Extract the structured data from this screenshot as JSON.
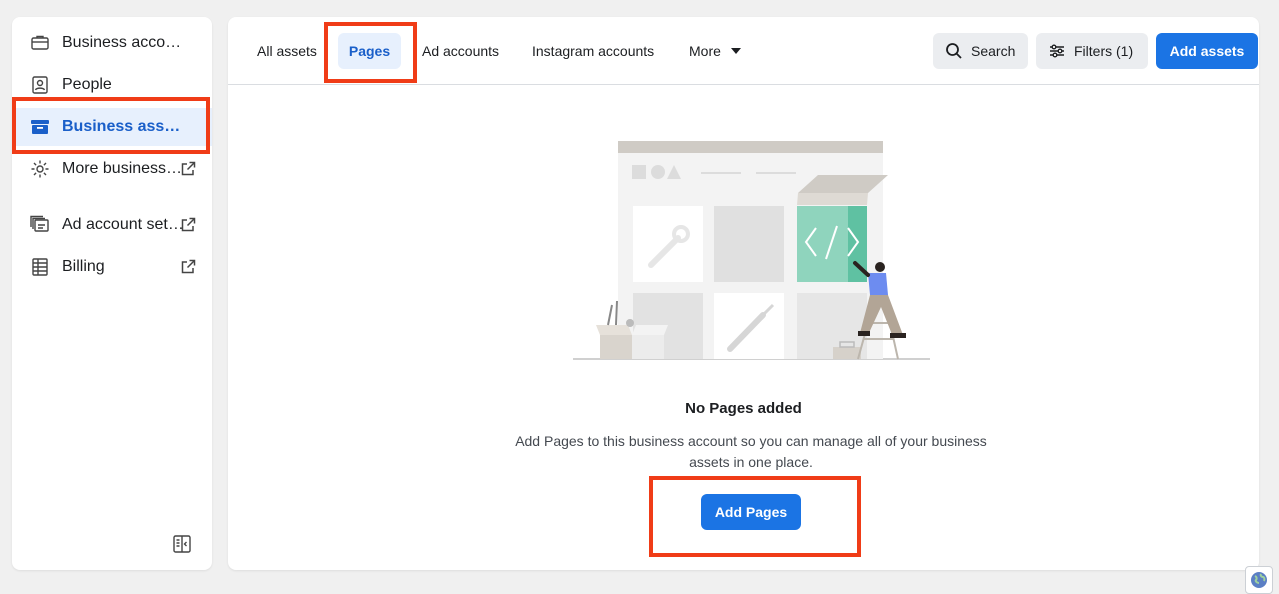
{
  "sidebar": {
    "items": [
      {
        "label": "Business account info",
        "icon": "briefcase-icon",
        "external": false,
        "active": false
      },
      {
        "label": "People",
        "icon": "person-badge-icon",
        "external": false,
        "active": false
      },
      {
        "label": "Business assets",
        "icon": "archive-box-icon",
        "external": false,
        "active": true
      },
      {
        "label": "More business settings",
        "icon": "gear-icon",
        "external": true,
        "active": false
      },
      {
        "label": "Ad account settings",
        "icon": "ad-account-icon",
        "external": true,
        "active": false
      },
      {
        "label": "Billing",
        "icon": "billing-icon",
        "external": true,
        "active": false
      }
    ]
  },
  "tabs": [
    {
      "label": "All assets",
      "active": false
    },
    {
      "label": "Pages",
      "active": true
    },
    {
      "label": "Ad accounts",
      "active": false
    },
    {
      "label": "Instagram accounts",
      "active": false
    },
    {
      "label": "More",
      "active": false
    }
  ],
  "toolbar": {
    "search_label": "Search",
    "filters_label": "Filters (1)",
    "add_assets_label": "Add assets"
  },
  "empty_state": {
    "title": "No Pages added",
    "description": "Add Pages to this business account so you can manage all of your business assets in one place.",
    "button_label": "Add Pages"
  },
  "colors": {
    "accent": "#1b74e4",
    "highlight": "#f03c17",
    "active_bg": "#e7f0fd"
  }
}
